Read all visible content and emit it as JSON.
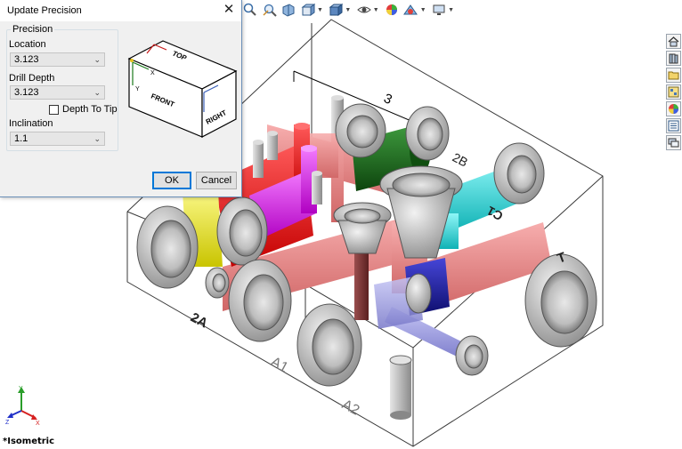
{
  "viewport": {
    "view_name": "*Isometric",
    "labels": {
      "port_2a": "2A",
      "port_a1": "A1",
      "port_a2": "A2",
      "port_2b": "2B",
      "port_c1": "C1",
      "port_t": "T",
      "dim_3": "3"
    },
    "triad": {
      "x": "X",
      "y": "Y",
      "z": "Z"
    }
  },
  "toolbar": {
    "icons": [
      "zoom-to-fit-icon",
      "zoom-area-icon",
      "section-view-icon",
      "view-orientation-icon",
      "display-style-icon",
      "hide-show-icon",
      "edit-appearance-icon",
      "apply-scene-icon",
      "view-settings-icon"
    ]
  },
  "taskpane": {
    "icons": [
      "home-icon",
      "design-library-icon",
      "file-explorer-icon",
      "view-palette-icon",
      "appearances-icon",
      "custom-properties-icon",
      "forum-icon"
    ]
  },
  "dialog": {
    "title": "Update Precision",
    "close_glyph": "✕",
    "group_title": "Precision",
    "location_label": "Location",
    "location_value": "3.123",
    "drill_depth_label": "Drill Depth",
    "drill_depth_value": "3.123",
    "depth_to_tip_label": "Depth To Tip",
    "depth_to_tip_checked": false,
    "inclination_label": "Inclination",
    "inclination_value": "1.1",
    "ok_label": "OK",
    "cancel_label": "Cancel",
    "preview": {
      "top": "TOP",
      "front": "FRONT",
      "right": "RIGHT",
      "x": "X",
      "y": "Y"
    }
  },
  "colors": {
    "accent": "#0078d7",
    "manifold_outline": "#3a3a3a",
    "red": "#ff1a1a",
    "magenta": "#e02ef0",
    "yellow": "#f2ee2a",
    "green": "#1d6a1d",
    "cyan": "#23e0e3",
    "salmon": "#f08a8a",
    "navy": "#1f1fa8",
    "lavender": "#9d9dea",
    "grey": "#b9b9b9"
  }
}
